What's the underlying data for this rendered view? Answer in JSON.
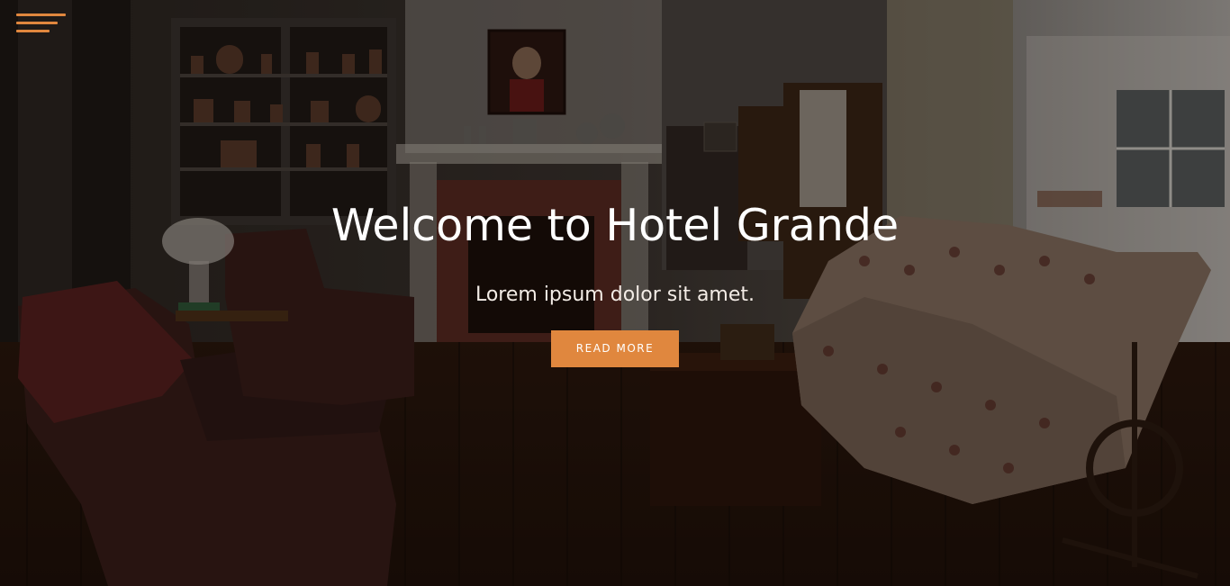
{
  "menu": {
    "icon": "hamburger-menu-icon",
    "color": "#e0873e"
  },
  "hero": {
    "title": "Welcome to Hotel Grande",
    "subtitle": "Lorem ipsum dolor sit amet.",
    "cta_label": "READ MORE",
    "accent_color": "#e0873e",
    "background_description_icon": "living-room-background"
  }
}
